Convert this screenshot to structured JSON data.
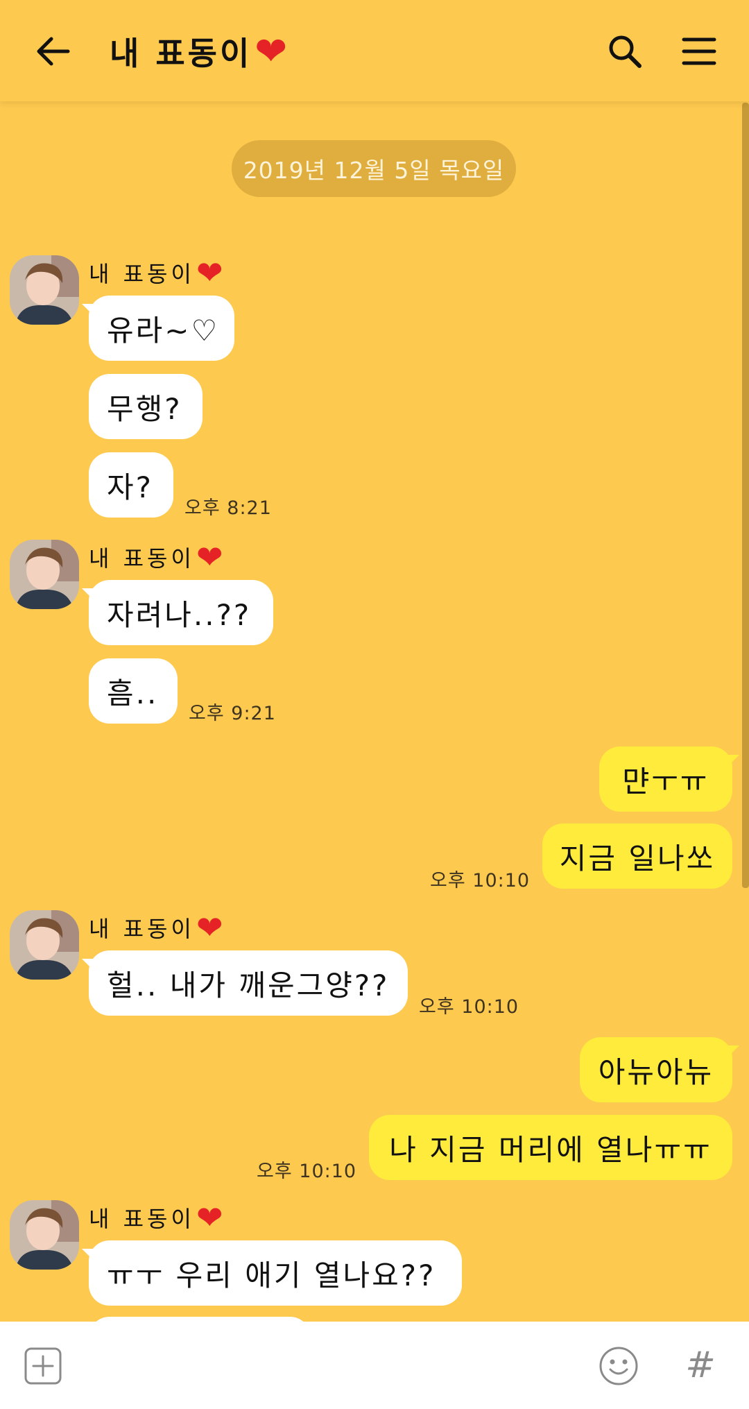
{
  "header": {
    "back_icon": "back-arrow-icon",
    "title": "내 표동이",
    "title_heart": "❤",
    "search_icon": "search-icon",
    "menu_icon": "menu-icon"
  },
  "date_divider": "2019년 12월 5일 목요일",
  "sender_name": "내 표동이",
  "sender_heart": "❤",
  "messages": [
    {
      "text": "유라~♡"
    },
    {
      "text": "무행?"
    },
    {
      "text": "자?",
      "time": "오후 8:21"
    },
    {
      "text": "자려나..??"
    },
    {
      "text": "흠..",
      "time": "오후 9:21"
    },
    {
      "text": "먄ㅜㅠ"
    },
    {
      "text": "지금 일나쏘",
      "time": "오후 10:10"
    },
    {
      "text": "헐.. 내가 깨운그양??",
      "time": "오후 10:10"
    },
    {
      "text": "아뉴아뉴"
    },
    {
      "text": "나 지금 머리에 열나ㅠㅠ",
      "time": "오후 10:10"
    },
    {
      "text": "ㅠㅜ 우리 애기 열나요??"
    }
  ],
  "input_bar": {
    "add_icon": "plus-square-icon",
    "emoji_icon": "emoji-icon",
    "hash_label": "#"
  },
  "colors": {
    "background": "#fec94f",
    "incoming_bubble": "#ffffff",
    "outgoing_bubble": "#ffeb3b",
    "heart": "#e52326"
  }
}
